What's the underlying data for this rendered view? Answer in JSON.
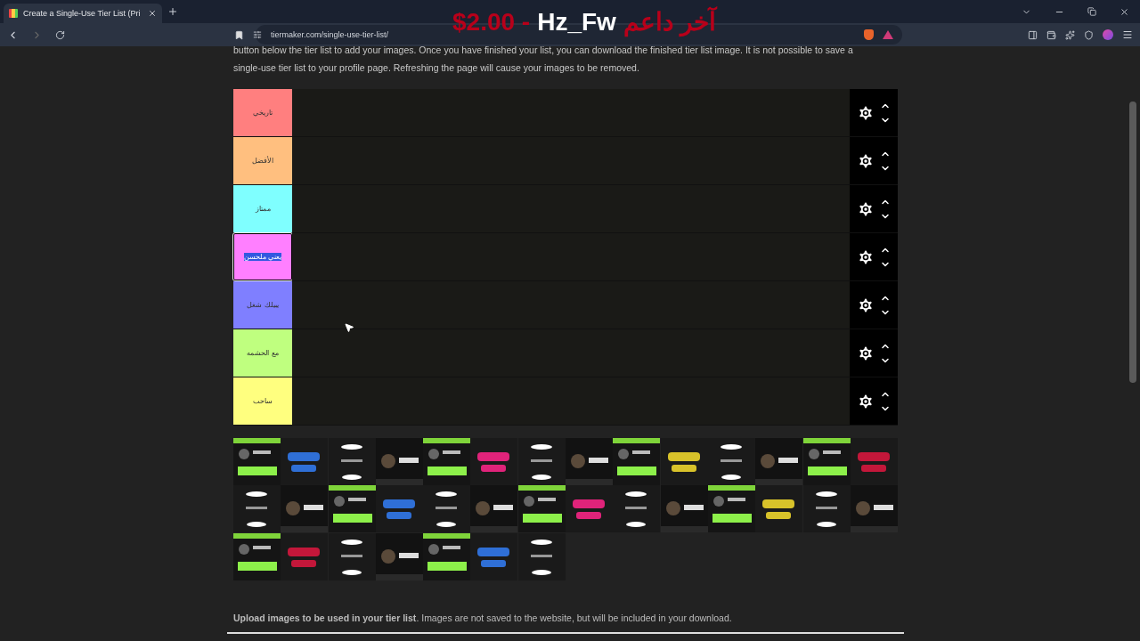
{
  "browser": {
    "tab": {
      "title": "Create a Single-Use Tier List (Pri",
      "selected": true
    },
    "url": "tiermaker.com/single-use-tier-list/"
  },
  "overlay": {
    "amount": "$2.00 -",
    "name": "Hz_Fw",
    "label": "آخر داعم"
  },
  "intro": [
    "button below the tier list to add your images. Once you have finished your list, you can download the finished tier list image. It is not possible to save a",
    "single-use tier list to your profile page. Refreshing the page will cause your images to be removed."
  ],
  "tiers": [
    {
      "label": "تاريخي",
      "color": "#ff7f7f",
      "focused": false
    },
    {
      "label": "الأفضل",
      "color": "#ffbf7f",
      "focused": false
    },
    {
      "label": "ممتاز",
      "color": "#7fffff",
      "focused": false
    },
    {
      "label": "يعني ملحسن",
      "color": "#ff7fff",
      "focused": true
    },
    {
      "label": "يبيلك شغل",
      "color": "#7f7fff",
      "focused": false
    },
    {
      "label": "مع الحشمه",
      "color": "#bfff7f",
      "focused": false
    },
    {
      "label": "ساحب",
      "color": "#ffff7f",
      "focused": false
    }
  ],
  "upload": {
    "title": "Upload images to be used in your tier list",
    "text": ". Images are not saved to the website, but will be included in your download."
  }
}
